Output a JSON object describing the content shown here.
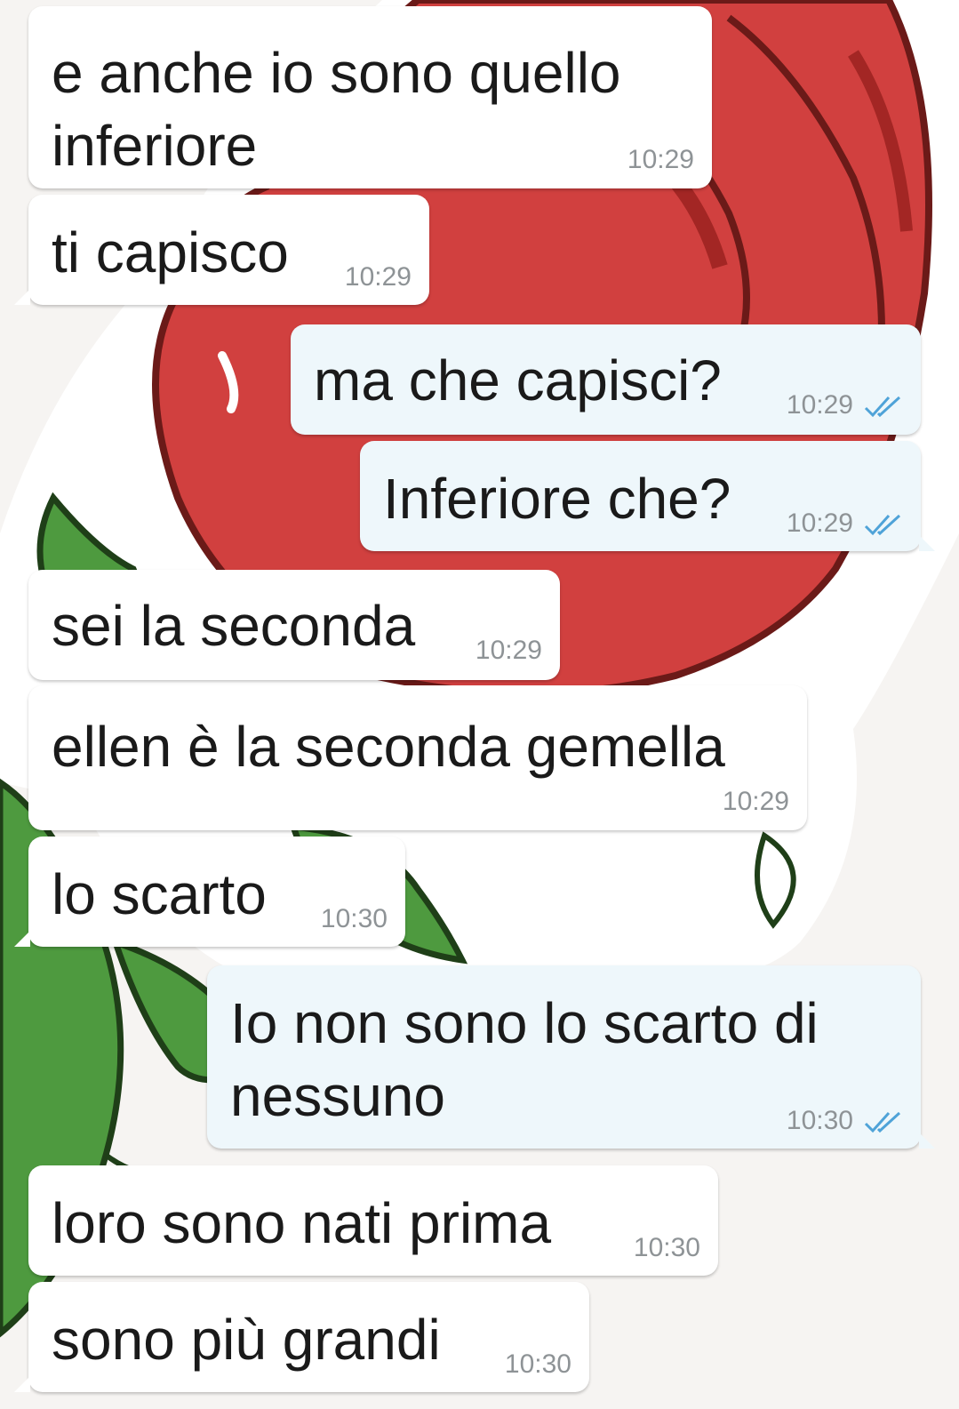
{
  "colors": {
    "incoming_bubble": "#ffffff",
    "outgoing_bubble": "#eef7fb",
    "text": "#1a1a1a",
    "timestamp": "#8e9396",
    "read_ticks": "#4fa3d8",
    "wallpaper_rose": "#d1403f",
    "wallpaper_leaf": "#4e9a3f"
  },
  "messages": [
    {
      "direction": "incoming",
      "lines": [
        "e anche io sono quello",
        "inferiore"
      ],
      "time": "10:29"
    },
    {
      "direction": "incoming",
      "lines": [
        "ti capisco"
      ],
      "time": "10:29"
    },
    {
      "direction": "outgoing",
      "lines": [
        "ma che capisci?"
      ],
      "time": "10:29",
      "status": "read-ticks-icon"
    },
    {
      "direction": "outgoing",
      "lines": [
        "Inferiore che?"
      ],
      "time": "10:29",
      "status": "read-ticks-icon"
    },
    {
      "direction": "incoming",
      "lines": [
        "sei la seconda"
      ],
      "time": "10:29"
    },
    {
      "direction": "incoming",
      "lines": [
        "ellen è la seconda gemella"
      ],
      "time": "10:29"
    },
    {
      "direction": "incoming",
      "lines": [
        "lo scarto"
      ],
      "time": "10:30"
    },
    {
      "direction": "outgoing",
      "lines": [
        "Io non sono lo scarto di",
        "nessuno"
      ],
      "time": "10:30",
      "status": "read-ticks-icon"
    },
    {
      "direction": "incoming",
      "lines": [
        "loro sono nati prima"
      ],
      "time": "10:30"
    },
    {
      "direction": "incoming",
      "lines": [
        "sono più grandi"
      ],
      "time": "10:30"
    }
  ]
}
